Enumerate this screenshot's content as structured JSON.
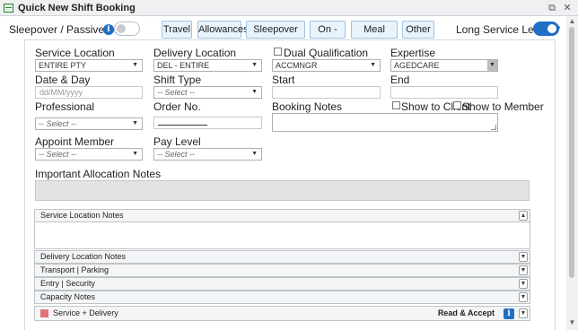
{
  "window": {
    "title": "Quick New Shift Booking",
    "restore_icon": "⧉",
    "close_icon": "✕"
  },
  "top": {
    "sleepover_label": "Sleepover / Passive Shift ?",
    "sleepover_on": false,
    "buttons": [
      "Travel",
      "Allowances",
      "Sleepover Hours",
      "On - Call",
      "Meal Breaks",
      "Other"
    ],
    "long_service_label": "Long Service Leave ?",
    "long_service_on": true
  },
  "form": {
    "service_location": {
      "label": "Service Location",
      "value": "ENTIRE PTY"
    },
    "delivery_location": {
      "label": "Delivery Location",
      "value": "DEL - ENTIRE"
    },
    "dual_qualification": {
      "label": "Dual Qualification",
      "value": "ACCMNGR"
    },
    "expertise": {
      "label": "Expertise",
      "value": "AGEDCARE"
    },
    "date_day": {
      "label": "Date & Day",
      "placeholder": "dd/MM/yyyy"
    },
    "shift_type": {
      "label": "Shift Type",
      "value": "-- Select --"
    },
    "start": {
      "label": "Start"
    },
    "end": {
      "label": "End"
    },
    "professional": {
      "label": "Professional",
      "value": "-- Select --"
    },
    "order_no": {
      "label": "Order No."
    },
    "booking_notes": {
      "label": "Booking Notes"
    },
    "show_to_client": "Show to Client",
    "show_to_member": "Show to Member",
    "appoint_member": {
      "label": "Appoint Member",
      "value": "-- Select --"
    },
    "pay_level": {
      "label": "Pay Level",
      "value": "-- Select --"
    },
    "important_notes_label": "Important Allocation Notes"
  },
  "sections": {
    "service_location_notes": "Service Location Notes",
    "delivery_location_notes": "Delivery Location Notes",
    "transport_parking": "Transport | Parking",
    "entry_security": "Entry | Security",
    "capacity_notes": "Capacity Notes",
    "service_delivery": "Service + Delivery",
    "read_accept": "Read & Accept"
  },
  "colors": {
    "accent": "#1f6fc5",
    "service_delivery_marker": "#e57373"
  }
}
